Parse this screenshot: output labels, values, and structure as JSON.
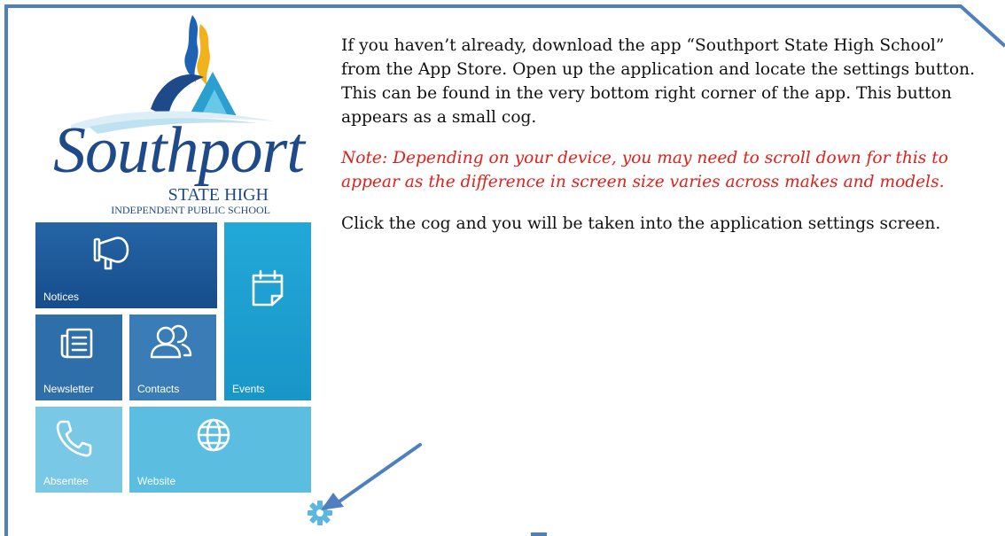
{
  "app": {
    "logo_text": "Southport",
    "logo_sub": "STATE HIGH",
    "logo_sub2": "INDEPENDENT PUBLIC SCHOOL"
  },
  "tiles": [
    {
      "label": "Notices",
      "icon": "megaphone-icon"
    },
    {
      "label": "Events",
      "icon": "calendar-icon"
    },
    {
      "label": "Newsletter",
      "icon": "newsletter-icon"
    },
    {
      "label": "Contacts",
      "icon": "contacts-icon"
    },
    {
      "label": "Absentee",
      "icon": "phone-icon"
    },
    {
      "label": "Website",
      "icon": "globe-icon"
    }
  ],
  "settings": {
    "icon": "gear-icon"
  },
  "instructions": {
    "para1": "If you haven’t already, download the app “Southport State High School” from the App Store. Open up the application and locate the settings button. This can be found in the very bottom right corner of the app. This button appears as a small cog.",
    "note": "Note: Depending on your device, you may need to scroll down for this to appear as the difference in screen size varies across makes and models.",
    "para3": "Click the cog and you will be taken into the application settings screen."
  },
  "colors": {
    "frame": "#4f7fbf",
    "arrow": "#4f7fbf",
    "note_text": "#e0201b",
    "notices_tile": "#1b5796",
    "events_tile": "#1ea0d2",
    "gear": "#5bb7de"
  }
}
